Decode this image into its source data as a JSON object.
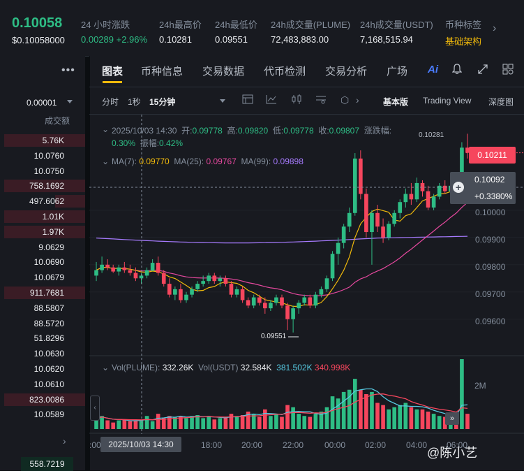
{
  "ticker": {
    "last_price": "0.10058",
    "last_price_usd": "$0.10058000",
    "change_label": "24 小时涨跌",
    "change_value": "0.00289 +2.96%",
    "high_label": "24h最高价",
    "high_value": "0.10281",
    "low_label": "24h最低价",
    "low_value": "0.09551",
    "vol_base_label": "24h成交量(PLUME)",
    "vol_base_value": "72,483,883.00",
    "vol_quote_label": "24h成交量(USDT)",
    "vol_quote_value": "7,168,515.94",
    "tag_label": "币种标签",
    "tag_value": "基础架构"
  },
  "order_book": {
    "precision": "0.00001",
    "header": "成交额",
    "rows": [
      {
        "amount": "5.76K",
        "depth": 0.95
      },
      {
        "amount": "10.0760",
        "depth": 0.0
      },
      {
        "amount": "10.0750",
        "depth": 0.0
      },
      {
        "amount": "758.1692",
        "depth": 0.95
      },
      {
        "amount": "497.6062",
        "depth": 0.35
      },
      {
        "amount": "1.01K",
        "depth": 0.95
      },
      {
        "amount": "1.97K",
        "depth": 0.95
      },
      {
        "amount": "9.0629",
        "depth": 0.0
      },
      {
        "amount": "10.0690",
        "depth": 0.0
      },
      {
        "amount": "10.0679",
        "depth": 0.0
      },
      {
        "amount": "911.7681",
        "depth": 0.95
      },
      {
        "amount": "88.5807",
        "depth": 0.0
      },
      {
        "amount": "88.5720",
        "depth": 0.0
      },
      {
        "amount": "51.8296",
        "depth": 0.0
      },
      {
        "amount": "10.0630",
        "depth": 0.0
      },
      {
        "amount": "10.0620",
        "depth": 0.0
      },
      {
        "amount": "10.0610",
        "depth": 0.0
      },
      {
        "amount": "823.0086",
        "depth": 0.95
      },
      {
        "amount": "10.0589",
        "depth": 0.0
      }
    ],
    "bottom_value": "558.7219"
  },
  "tabs": [
    "图表",
    "币种信息",
    "交易数据",
    "代币检测",
    "交易分析",
    "广场"
  ],
  "ai_label": "Ai",
  "toolbar": {
    "timeframes": [
      "分时",
      "1秒",
      "15分钟"
    ],
    "views": [
      "基本版",
      "Trading View",
      "深度图"
    ]
  },
  "ohlc": {
    "date": "2025/10/03 14:30",
    "open_label": "开:",
    "open": "0.09778",
    "high_label": "高:",
    "high": "0.09820",
    "low_label": "低:",
    "low": "0.09778",
    "close_label": "收:",
    "close": "0.09807",
    "chg_label": "涨跌幅:",
    "chg": "0.30%",
    "amp_label": "振幅:",
    "amp": "0.42%"
  },
  "ma": {
    "ma7_label": "MA(7):",
    "ma7": "0.09770",
    "ma7_color": "#f0b90b",
    "ma25_label": "MA(25):",
    "ma25": "0.09767",
    "ma25_color": "#e5489e",
    "ma99_label": "MA(99):",
    "ma99": "0.09898",
    "ma99_color": "#a77bff"
  },
  "price_axis": [
    "0.10000",
    "0.09900",
    "0.09800",
    "0.09700",
    "0.09600"
  ],
  "current_price_tag": "0.10211",
  "crosshair": {
    "price": "0.10092",
    "pct": "+0.3380%"
  },
  "high_marker": "0.10281",
  "low_marker": "0.09551",
  "volume": {
    "vol_base_label": "Vol(PLUME):",
    "vol_base": "332.26K",
    "vol_quote_label": "Vol(USDT)",
    "vol_quote": "32.584K",
    "ma1": "381.502K",
    "ma2": "340.998K",
    "axis_label": "2M"
  },
  "time_axis": [
    ":00",
    "18:00",
    "20:00",
    "22:00",
    "00:00",
    "02:00",
    "04:00",
    "06:00"
  ],
  "crosshair_time": "2025/10/03 14:30",
  "watermark": "@陈小艺",
  "colors": {
    "up": "#2ebd85",
    "down": "#f6465d",
    "accent": "#f0b90b"
  },
  "chart_data": {
    "type": "candlestick",
    "price_range": [
      0.0953,
      0.103
    ],
    "candles": [
      [
        0.0976,
        0.0981,
        0.0974,
        0.0978
      ],
      [
        0.0978,
        0.0983,
        0.0977,
        0.098
      ],
      [
        0.098,
        0.0982,
        0.0978,
        0.0979
      ],
      [
        0.0979,
        0.098,
        0.0977,
        0.09775
      ],
      [
        0.09775,
        0.098,
        0.0976,
        0.0979
      ],
      [
        0.0979,
        0.0981,
        0.0977,
        0.0978
      ],
      [
        0.0978,
        0.098,
        0.0976,
        0.0977
      ],
      [
        0.0977,
        0.0979,
        0.0974,
        0.0975
      ],
      [
        0.0975,
        0.0977,
        0.0973,
        0.0976
      ],
      [
        0.0976,
        0.0979,
        0.0975,
        0.0978
      ],
      [
        0.09778,
        0.0982,
        0.09778,
        0.09807
      ],
      [
        0.09807,
        0.0983,
        0.0976,
        0.0977
      ],
      [
        0.0977,
        0.0978,
        0.0972,
        0.0973
      ],
      [
        0.0973,
        0.0975,
        0.0968,
        0.0969
      ],
      [
        0.0969,
        0.0972,
        0.0967,
        0.0971
      ],
      [
        0.0971,
        0.0973,
        0.0966,
        0.0967
      ],
      [
        0.0967,
        0.097,
        0.0966,
        0.0969
      ],
      [
        0.0969,
        0.0972,
        0.0968,
        0.0971
      ],
      [
        0.0971,
        0.0974,
        0.097,
        0.0973
      ],
      [
        0.0973,
        0.0976,
        0.0972,
        0.0974
      ],
      [
        0.0974,
        0.0977,
        0.0973,
        0.0976
      ],
      [
        0.0976,
        0.0977,
        0.0973,
        0.0974
      ],
      [
        0.0974,
        0.0976,
        0.0972,
        0.0975
      ],
      [
        0.0975,
        0.0976,
        0.0972,
        0.0973
      ],
      [
        0.0973,
        0.0974,
        0.0968,
        0.0969
      ],
      [
        0.0969,
        0.0972,
        0.0968,
        0.0971
      ],
      [
        0.0971,
        0.0972,
        0.0966,
        0.0967
      ],
      [
        0.0967,
        0.0968,
        0.0964,
        0.0965
      ],
      [
        0.0965,
        0.0969,
        0.0964,
        0.0968
      ],
      [
        0.0968,
        0.0969,
        0.0965,
        0.0966
      ],
      [
        0.0966,
        0.0968,
        0.0962,
        0.0964
      ],
      [
        0.0964,
        0.0967,
        0.0963,
        0.0966
      ],
      [
        0.0966,
        0.0969,
        0.0965,
        0.0968
      ],
      [
        0.0968,
        0.0969,
        0.0964,
        0.0965
      ],
      [
        0.0965,
        0.0966,
        0.0956,
        0.096
      ],
      [
        0.096,
        0.0965,
        0.09551,
        0.0964
      ],
      [
        0.0964,
        0.0967,
        0.0962,
        0.0966
      ],
      [
        0.0966,
        0.0969,
        0.0965,
        0.0968
      ],
      [
        0.0968,
        0.0969,
        0.0964,
        0.0965
      ],
      [
        0.0965,
        0.097,
        0.0964,
        0.0969
      ],
      [
        0.0969,
        0.0972,
        0.0968,
        0.0971
      ],
      [
        0.0971,
        0.0976,
        0.097,
        0.0975
      ],
      [
        0.0975,
        0.0985,
        0.0974,
        0.0984
      ],
      [
        0.0984,
        0.099,
        0.098,
        0.0988
      ],
      [
        0.0988,
        0.0995,
        0.0986,
        0.0994
      ],
      [
        0.0994,
        0.1001,
        0.0992,
        0.0999
      ],
      [
        0.0999,
        0.1021,
        0.0998,
        0.1019
      ],
      [
        0.1019,
        0.1022,
        0.1004,
        0.1006
      ],
      [
        0.1006,
        0.1008,
        0.099,
        0.0992
      ],
      [
        0.0992,
        0.1,
        0.098,
        0.0999
      ],
      [
        0.0999,
        0.1002,
        0.0992,
        0.0994
      ],
      [
        0.0994,
        0.0997,
        0.0988,
        0.099
      ],
      [
        0.099,
        0.0996,
        0.0989,
        0.0995
      ],
      [
        0.0995,
        0.1,
        0.0994,
        0.0999
      ],
      [
        0.0999,
        0.1004,
        0.0997,
        0.1003
      ],
      [
        0.1003,
        0.1008,
        0.1001,
        0.1006
      ],
      [
        0.1006,
        0.101,
        0.1002,
        0.1004
      ],
      [
        0.1004,
        0.1012,
        0.1003,
        0.101
      ],
      [
        0.101,
        0.1011,
        0.1005,
        0.1007
      ],
      [
        0.1007,
        0.1009,
        0.1,
        0.1001
      ],
      [
        0.1001,
        0.1006,
        0.1,
        0.1005
      ],
      [
        0.1005,
        0.101,
        0.1004,
        0.1009
      ],
      [
        0.1009,
        0.1011,
        0.1006,
        0.1007
      ],
      [
        0.1007,
        0.101,
        0.1006,
        0.1009
      ],
      [
        0.1009,
        0.101,
        0.1007,
        0.1008
      ],
      [
        0.1008,
        0.1025,
        0.1007,
        0.1023
      ],
      [
        0.1023,
        0.10281,
        0.1019,
        0.10211
      ]
    ],
    "volume": [
      0.25,
      0.3,
      0.2,
      0.15,
      0.2,
      0.22,
      0.18,
      0.2,
      0.2,
      0.3,
      0.18,
      0.35,
      0.25,
      0.3,
      0.28,
      0.3,
      0.25,
      0.3,
      0.32,
      0.25,
      0.3,
      0.22,
      0.25,
      0.28,
      0.35,
      0.3,
      0.32,
      0.4,
      0.35,
      0.28,
      0.45,
      0.3,
      0.35,
      0.28,
      0.55,
      0.5,
      0.35,
      0.3,
      0.28,
      0.35,
      0.4,
      0.5,
      0.75,
      0.7,
      0.85,
      0.9,
      1.15,
      0.9,
      0.8,
      0.85,
      0.6,
      0.55,
      0.45,
      0.5,
      0.55,
      0.6,
      0.5,
      0.45,
      0.45,
      0.4,
      0.35,
      0.3,
      0.28,
      0.3,
      0.25,
      1.6,
      0.35
    ]
  }
}
